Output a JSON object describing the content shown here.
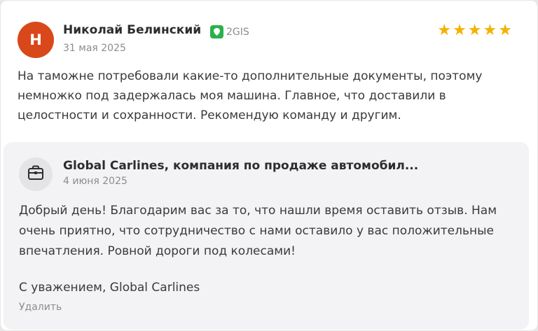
{
  "review": {
    "avatar_letter": "Н",
    "author": "Николай Белинский",
    "source_name": "2GIS",
    "date": "31 мая 2025",
    "rating": 5,
    "stars": [
      "★",
      "★",
      "★",
      "★",
      "★"
    ],
    "text": "На таможне потребовали какие-то дополнительные документы, поэтому немножко под задержалась моя машина. Главное, что доставили в целостности и сохранности. Рекомендую команду и другим."
  },
  "reply": {
    "author": "Global Carlines, компания по продаже автомобил...",
    "date": "4 июня 2025",
    "text": "Добрый день! Благодарим вас за то, что нашли время оставить отзыв. Нам очень приятно, что сотрудничество с нами оставило у вас положительные впечатления. Ровной дороги под колесами!",
    "signature": "С уважением, Global Carlines",
    "delete_label": "Удалить"
  },
  "colors": {
    "avatar_bg": "#d9481a",
    "star": "#f5b100",
    "source_logo": "#2bb04a",
    "reply_bg": "#f3f3f5"
  },
  "icons": {
    "source": "2gis-logo-icon",
    "reply_avatar": "briefcase-icon",
    "star": "star-icon"
  }
}
